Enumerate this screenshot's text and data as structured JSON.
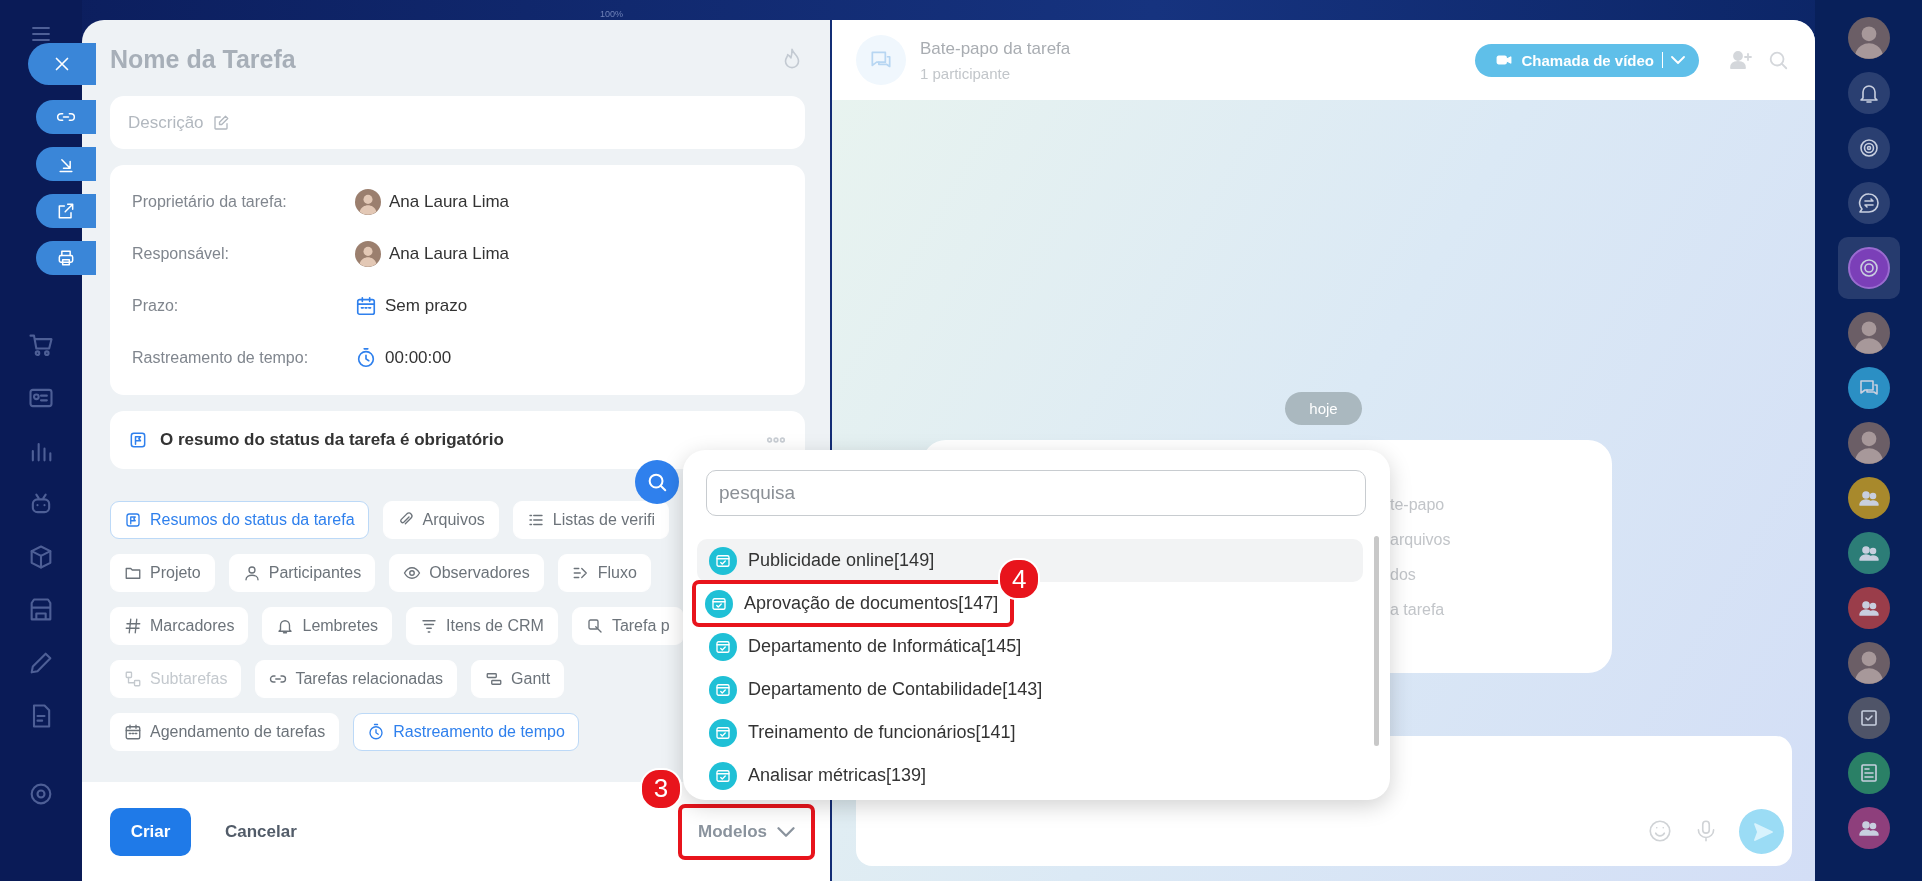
{
  "top_bar": {
    "zoom_label": "100%"
  },
  "left_rail": {
    "items": [
      {
        "kind": "cart"
      },
      {
        "kind": "idcard"
      },
      {
        "kind": "chart"
      },
      {
        "kind": "robot"
      },
      {
        "kind": "cube"
      },
      {
        "kind": "store"
      },
      {
        "kind": "pencil"
      },
      {
        "kind": "doc"
      },
      {
        "kind": "gear"
      }
    ]
  },
  "task": {
    "title_placeholder": "Nome da Tarefa",
    "description_placeholder": "Descrição",
    "fields": [
      {
        "label": "Proprietário da tarefa:",
        "kind": "person",
        "value": "Ana Laura Lima"
      },
      {
        "label": "Responsável:",
        "kind": "person",
        "value": "Ana Laura Lima"
      },
      {
        "label": "Prazo:",
        "kind": "deadline",
        "value": "Sem prazo"
      },
      {
        "label": "Rastreamento de tempo:",
        "kind": "timer",
        "value": "00:00:00"
      }
    ],
    "status_summary": "O resumo do status da tarefa é obrigatório",
    "chip_rows": [
      [
        {
          "label": "Resumos do status da tarefa",
          "kind": "flag",
          "selected": true,
          "disabled": false
        },
        {
          "label": "Arquivos",
          "kind": "clip",
          "selected": false,
          "disabled": false
        },
        {
          "label": "Listas de verifi",
          "kind": "checklist",
          "selected": false,
          "disabled": false
        }
      ],
      [
        {
          "label": "Projeto",
          "kind": "folder",
          "selected": false,
          "disabled": false
        },
        {
          "label": "Participantes",
          "kind": "person",
          "selected": false,
          "disabled": false
        },
        {
          "label": "Observadores",
          "kind": "eye",
          "selected": false,
          "disabled": false
        },
        {
          "label": "Fluxo",
          "kind": "flow",
          "selected": false,
          "disabled": false
        }
      ],
      [
        {
          "label": "Marcadores",
          "kind": "hash",
          "selected": false,
          "disabled": false
        },
        {
          "label": "Lembretes",
          "kind": "bell",
          "selected": false,
          "disabled": false
        },
        {
          "label": "Itens de CRM",
          "kind": "crm",
          "selected": false,
          "disabled": false
        },
        {
          "label": "Tarefa p",
          "kind": "task",
          "selected": false,
          "disabled": false
        }
      ],
      [
        {
          "label": "Subtarefas",
          "kind": "subtask",
          "selected": false,
          "disabled": true
        },
        {
          "label": "Tarefas relacionadas",
          "kind": "link",
          "selected": false,
          "disabled": false
        },
        {
          "label": "Gantt",
          "kind": "gantt",
          "selected": false,
          "disabled": false
        }
      ],
      [
        {
          "label": "Agendamento de tarefas",
          "kind": "calendar",
          "selected": false,
          "disabled": false
        },
        {
          "label": "Rastreamento de tempo",
          "kind": "timer",
          "selected": true,
          "disabled": false
        }
      ]
    ],
    "buttons": {
      "create": "Criar",
      "cancel": "Cancelar",
      "templates": {
        "label": "Modelos",
        "callout": "3"
      }
    }
  },
  "templates_menu": {
    "search": {
      "placeholder": "pesquisa"
    },
    "items": [
      {
        "label": "Publicidade online[149]",
        "highlighted": true
      },
      {
        "label": "Aprovação de documentos[147]",
        "highlighted": false,
        "callout": "4"
      },
      {
        "label": "Departamento de Informática[145]",
        "highlighted": false
      },
      {
        "label": "Departamento de Contabilidade[143]",
        "highlighted": false
      },
      {
        "label": "Treinamento de funcionários[141]",
        "highlighted": false
      },
      {
        "label": "Analisar métricas[139]",
        "highlighted": false
      }
    ]
  },
  "chat": {
    "title": "Bate-papo da tarefa",
    "subtitle": "1 participante",
    "video_call": "Chamada de vídeo",
    "date_divider": "hoje",
    "message_lines": [
      "te-papo",
      "arquivos",
      "dos",
      "a tarefa"
    ]
  },
  "right_rail": {
    "items": [
      {
        "kind": "avatar",
        "selected": false
      },
      {
        "kind": "bell",
        "selected": false
      },
      {
        "kind": "spiral",
        "selected": false
      },
      {
        "kind": "swap",
        "selected": false
      },
      {
        "kind": "assistant",
        "selected": true,
        "color": "#7b3fb8"
      },
      {
        "kind": "avatar",
        "selected": false
      },
      {
        "kind": "chat",
        "selected": false,
        "color": "#2b8fc4"
      },
      {
        "kind": "avatar",
        "selected": false
      },
      {
        "kind": "group",
        "selected": false,
        "color": "#a8892c"
      },
      {
        "kind": "group",
        "selected": false,
        "color": "#2c7d77"
      },
      {
        "kind": "group",
        "selected": false,
        "color": "#9a3d4a"
      },
      {
        "kind": "avatar",
        "selected": false
      },
      {
        "kind": "taskbox",
        "selected": false,
        "color": "#4f5468"
      },
      {
        "kind": "news",
        "selected": false,
        "color": "#2a8066"
      },
      {
        "kind": "group",
        "selected": false,
        "color": "#8e3f7c"
      }
    ]
  }
}
